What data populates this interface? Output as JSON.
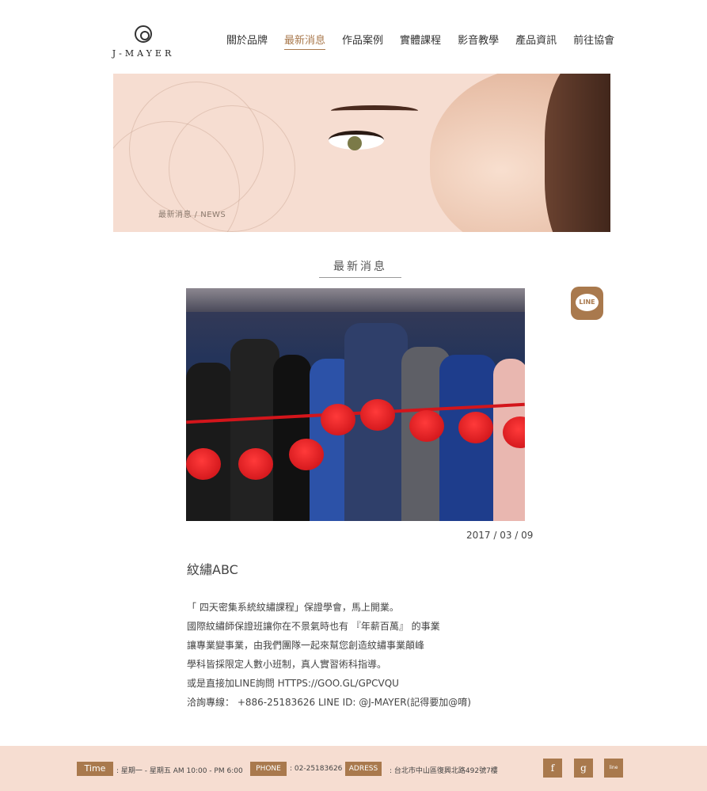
{
  "brand": {
    "logo_text": "J-MAYER"
  },
  "nav": {
    "items": [
      {
        "label": "關於品牌"
      },
      {
        "label": "最新消息",
        "active": true
      },
      {
        "label": "作品案例"
      },
      {
        "label": "實體課程"
      },
      {
        "label": "影音教學"
      },
      {
        "label": "產品資訊"
      },
      {
        "label": "前往協會"
      }
    ]
  },
  "hero": {
    "breadcrumb": "最新消息 / NEWS"
  },
  "section": {
    "title": "最新消息"
  },
  "article": {
    "date": "2017 / 03 / 09",
    "title": "紋繡ABC",
    "lines": [
      "「 四天密集系統紋繡課程」保證學會，馬上開業。",
      "國際紋繡師保證班讓你在不景氣時也有 『年薪百萬』 的事業",
      "讓專業變事業，由我們團隊一起來幫您創造紋繡事業顛峰",
      "學科皆採限定人數小班制，真人實習術科指導。",
      "或是直接加LINE詢問 HTTPS://GOO.GL/GPCVQU",
      "洽詢專線： +886-25183626 LINE ID: @J-MAYER(記得要加@唷)"
    ]
  },
  "line_button": {
    "label": "LINE"
  },
  "footer": {
    "time_tag": "Time",
    "time_text": ": 星期一 - 星期五 AM 10:00 - PM 6:00",
    "phone_tag": "PHONE",
    "phone_text": ": 02-25183626",
    "address_tag": "ADRESS",
    "address_text": ": 台北市中山區復興北路492號7樓",
    "social": [
      {
        "label": "f",
        "icon": "facebook-icon"
      },
      {
        "label": "g",
        "icon": "google-icon"
      },
      {
        "label": "line",
        "icon": "line-icon"
      }
    ]
  },
  "colors": {
    "accent": "#a9794d",
    "banner_bg": "#f6ddd1"
  }
}
